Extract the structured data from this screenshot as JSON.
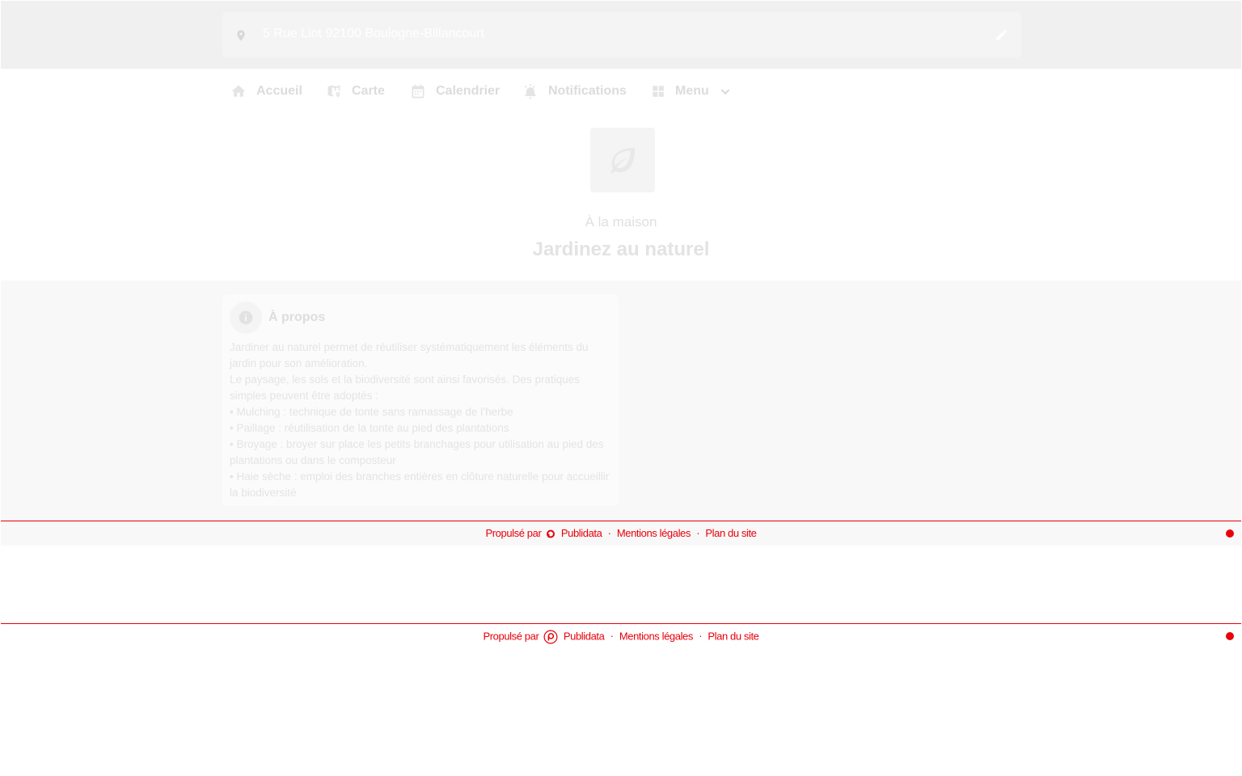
{
  "address": {
    "text": "5 Rue Liot 92100 Boulogne-Billancourt",
    "pin_icon": "location-pin-icon",
    "edit_icon": "pencil-icon"
  },
  "nav": {
    "home": "Accueil",
    "map": "Carte",
    "calendar": "Calendrier",
    "notifications": "Notifications",
    "menu": "Menu"
  },
  "hero": {
    "icon": "leaf-icon",
    "category": "À la maison",
    "title": "Jardinez au naturel"
  },
  "about": {
    "title": "À propos",
    "lines": [
      "Jardiner au naturel permet de réutiliser systématiquement les éléments du jardin pour son amélioration.",
      "Le paysage, les sols et la biodiversité sont ainsi favorisés. Des pratiques simples peuvent être adoptés :",
      "• Mulching : technique de tonte sans ramassage de l’herbe",
      "• Paillage : réutilisation de la tonte au pied des plantations",
      "• Broyage : broyer sur place les petits branchages pour utilisation au pied des plantations ou dans le composteur",
      "• Haie sèche : emploi des branches entières en clôture naturelle pour accueillir la biodiversité"
    ]
  },
  "footer": {
    "powered_by": "Propulsé par",
    "brand": "Publidata",
    "legal": "Mentions légales",
    "sitemap": "Plan du site",
    "separator": "·"
  },
  "colors": {
    "accent": "#e8000a",
    "topbar": "#f0f0f0",
    "content_bg": "#f8f8f8"
  }
}
